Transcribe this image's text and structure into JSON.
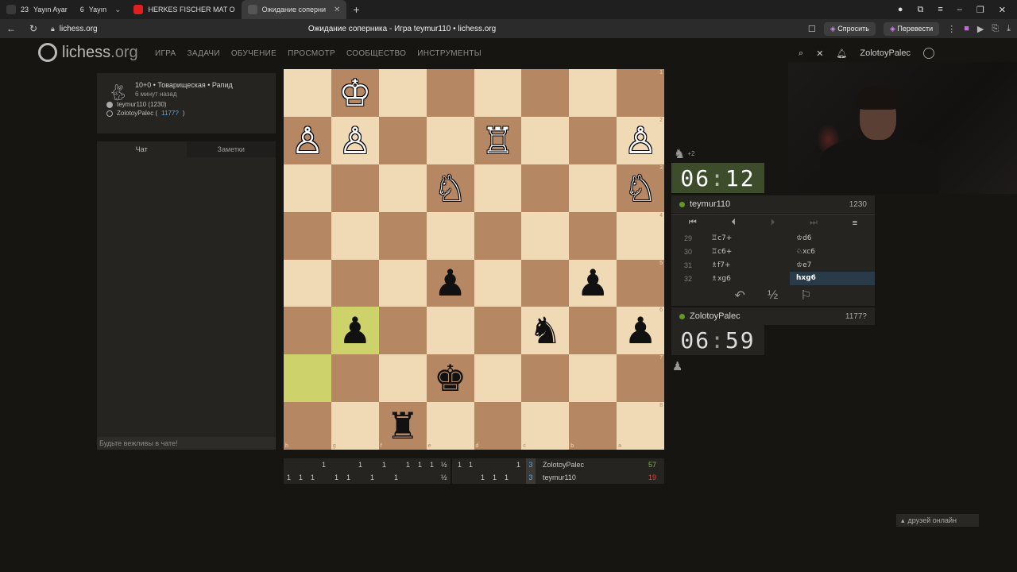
{
  "browser": {
    "tabs": [
      {
        "count": "23",
        "label": "Yayın Ayar"
      },
      {
        "count": "6",
        "label": "Yayın"
      },
      {
        "label": "HERKES FISCHER MAT O"
      },
      {
        "label": "Ожидание соперни"
      }
    ],
    "url": "lichess.org",
    "page_title": "Ожидание соперника - Игра teymur110 • lichess.org",
    "ask_label": "Спросить",
    "translate_label": "Перевести"
  },
  "header": {
    "logo_main": "lichess",
    "logo_tld": ".org",
    "nav": [
      "ИГРА",
      "ЗАДАЧИ",
      "ОБУЧЕНИЕ",
      "ПРОСМОТР",
      "СООБЩЕСТВО",
      "ИНСТРУМЕНТЫ"
    ],
    "username": "ZolotoyPalec"
  },
  "game_info": {
    "line1": "10+0 • Товарищеская • Рапид",
    "line2": "6 минут назад",
    "white_player": "teymur110 (1230)",
    "black_player_name": "ZolotoyPalec (",
    "black_player_rating": "1177?",
    "black_player_close": ")"
  },
  "chat": {
    "tab_chat": "Чат",
    "tab_notes": "Заметки",
    "placeholder": "Будьте вежливы в чате!"
  },
  "board": {
    "orientation": "black",
    "rank_labels": [
      "1",
      "2",
      "3",
      "4",
      "5",
      "6",
      "7",
      "8"
    ],
    "file_labels": [
      "h",
      "g",
      "f",
      "e",
      "d",
      "c",
      "b",
      "a"
    ],
    "rows": [
      [
        "",
        "♔",
        "",
        "",
        "",
        "",
        "",
        ""
      ],
      [
        "♙",
        "♙",
        "",
        "",
        "♖",
        "",
        "",
        "♙"
      ],
      [
        "",
        "",
        "",
        "♘",
        "",
        "",
        "",
        "♘"
      ],
      [
        "",
        "",
        "",
        "",
        "",
        "",
        "",
        ""
      ],
      [
        "",
        "",
        "",
        "♟",
        "",
        "",
        "♟",
        ""
      ],
      [
        "",
        "♟",
        "",
        "",
        "",
        "♞",
        "",
        "♟"
      ],
      [
        "",
        "",
        "",
        "♚",
        "",
        "",
        "",
        ""
      ],
      [
        "",
        "",
        "♜",
        "",
        "",
        "",
        "",
        ""
      ]
    ],
    "colors": [
      [
        "w",
        "b",
        "w",
        "b",
        "w",
        "b",
        "w",
        "b"
      ],
      [
        "w",
        "b",
        "w",
        "b",
        "w",
        "b",
        "w",
        "b"
      ],
      [
        "w",
        "b",
        "w",
        "b",
        "w",
        "b",
        "w",
        "b"
      ],
      [
        "w",
        "b",
        "w",
        "b",
        "w",
        "b",
        "w",
        "b"
      ],
      [
        "w",
        "b",
        "w",
        "b",
        "w",
        "b",
        "w",
        "b"
      ],
      [
        "w",
        "b",
        "w",
        "b",
        "w",
        "b",
        "w",
        "b"
      ],
      [
        "w",
        "b",
        "w",
        "b",
        "w",
        "b",
        "w",
        "b"
      ],
      [
        "w",
        "b",
        "w",
        "b",
        "w",
        "b",
        "w",
        "b"
      ]
    ],
    "highlights": [
      "5,1",
      "6,0"
    ]
  },
  "crosstable": {
    "row1_left": [
      "1",
      "1",
      "1",
      "1",
      "1",
      "1",
      "½"
    ],
    "row1_right": [
      "1",
      "1",
      "1"
    ],
    "row2_left": [
      "1",
      "1",
      "1",
      "1",
      "1",
      "1",
      "1",
      "½"
    ],
    "row2_right": [
      "1",
      "1",
      "1"
    ],
    "player1_count": "3",
    "player1": "ZolotoyPalec",
    "player1_score": "57",
    "player2_count": "3",
    "player2": "teymur110",
    "player2_score": "19"
  },
  "right_panel": {
    "material_top": "+2",
    "clock_top_min": "06",
    "clock_top_sec": "12",
    "top_player": "teymur110",
    "top_rating": "1230",
    "moves": [
      {
        "n": "29",
        "w": "♖c7+",
        "b": "♔d6"
      },
      {
        "n": "30",
        "w": "♖c6+",
        "b": "♘xc6"
      },
      {
        "n": "31",
        "w": "♗f7+",
        "b": "♔e7"
      },
      {
        "n": "32",
        "w": "♗xg6",
        "b": "hxg6"
      }
    ],
    "bottom_player": "ZolotoyPalec",
    "bottom_rating": "1177?",
    "clock_bottom_min": "06",
    "clock_bottom_sec": "59",
    "draw_label": "½"
  },
  "friends_label": "друзей онлайн"
}
